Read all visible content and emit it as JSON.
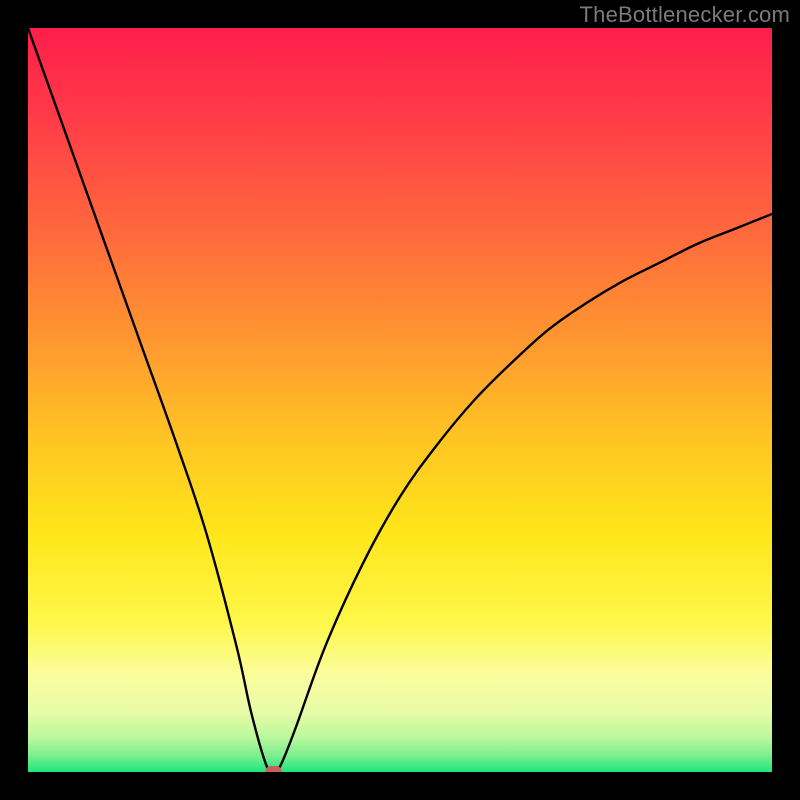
{
  "watermark": "TheBottlenecker.com",
  "chart_data": {
    "type": "line",
    "title": "",
    "xlabel": "",
    "ylabel": "",
    "xlim": [
      0,
      100
    ],
    "ylim": [
      0,
      100
    ],
    "grid": false,
    "legend": false,
    "series": [
      {
        "name": "bottleneck-curve",
        "x": [
          0,
          5,
          10,
          15,
          20,
          24,
          28,
          30,
          32,
          33,
          34,
          36,
          40,
          45,
          50,
          55,
          60,
          65,
          70,
          75,
          80,
          85,
          90,
          95,
          100
        ],
        "values": [
          100,
          86,
          72,
          58,
          44,
          32,
          17,
          8,
          1,
          0,
          1,
          6,
          17,
          28,
          37,
          44,
          50,
          55,
          59.5,
          63,
          66,
          68.5,
          71,
          73,
          75
        ]
      }
    ],
    "marker": {
      "x": 33,
      "y": 0,
      "color": "#c8615c"
    },
    "gradient_stops": [
      {
        "offset": 0.0,
        "color": "#ff1e4a"
      },
      {
        "offset": 0.12,
        "color": "#ff3b48"
      },
      {
        "offset": 0.28,
        "color": "#ff6b3c"
      },
      {
        "offset": 0.42,
        "color": "#ff9730"
      },
      {
        "offset": 0.55,
        "color": "#ffc423"
      },
      {
        "offset": 0.68,
        "color": "#ffe61a"
      },
      {
        "offset": 0.8,
        "color": "#fef84a"
      },
      {
        "offset": 0.87,
        "color": "#fbfd9e"
      },
      {
        "offset": 0.92,
        "color": "#e7fca6"
      },
      {
        "offset": 0.955,
        "color": "#b8f79c"
      },
      {
        "offset": 0.978,
        "color": "#7bef8e"
      },
      {
        "offset": 1.0,
        "color": "#1fe47f"
      }
    ]
  }
}
